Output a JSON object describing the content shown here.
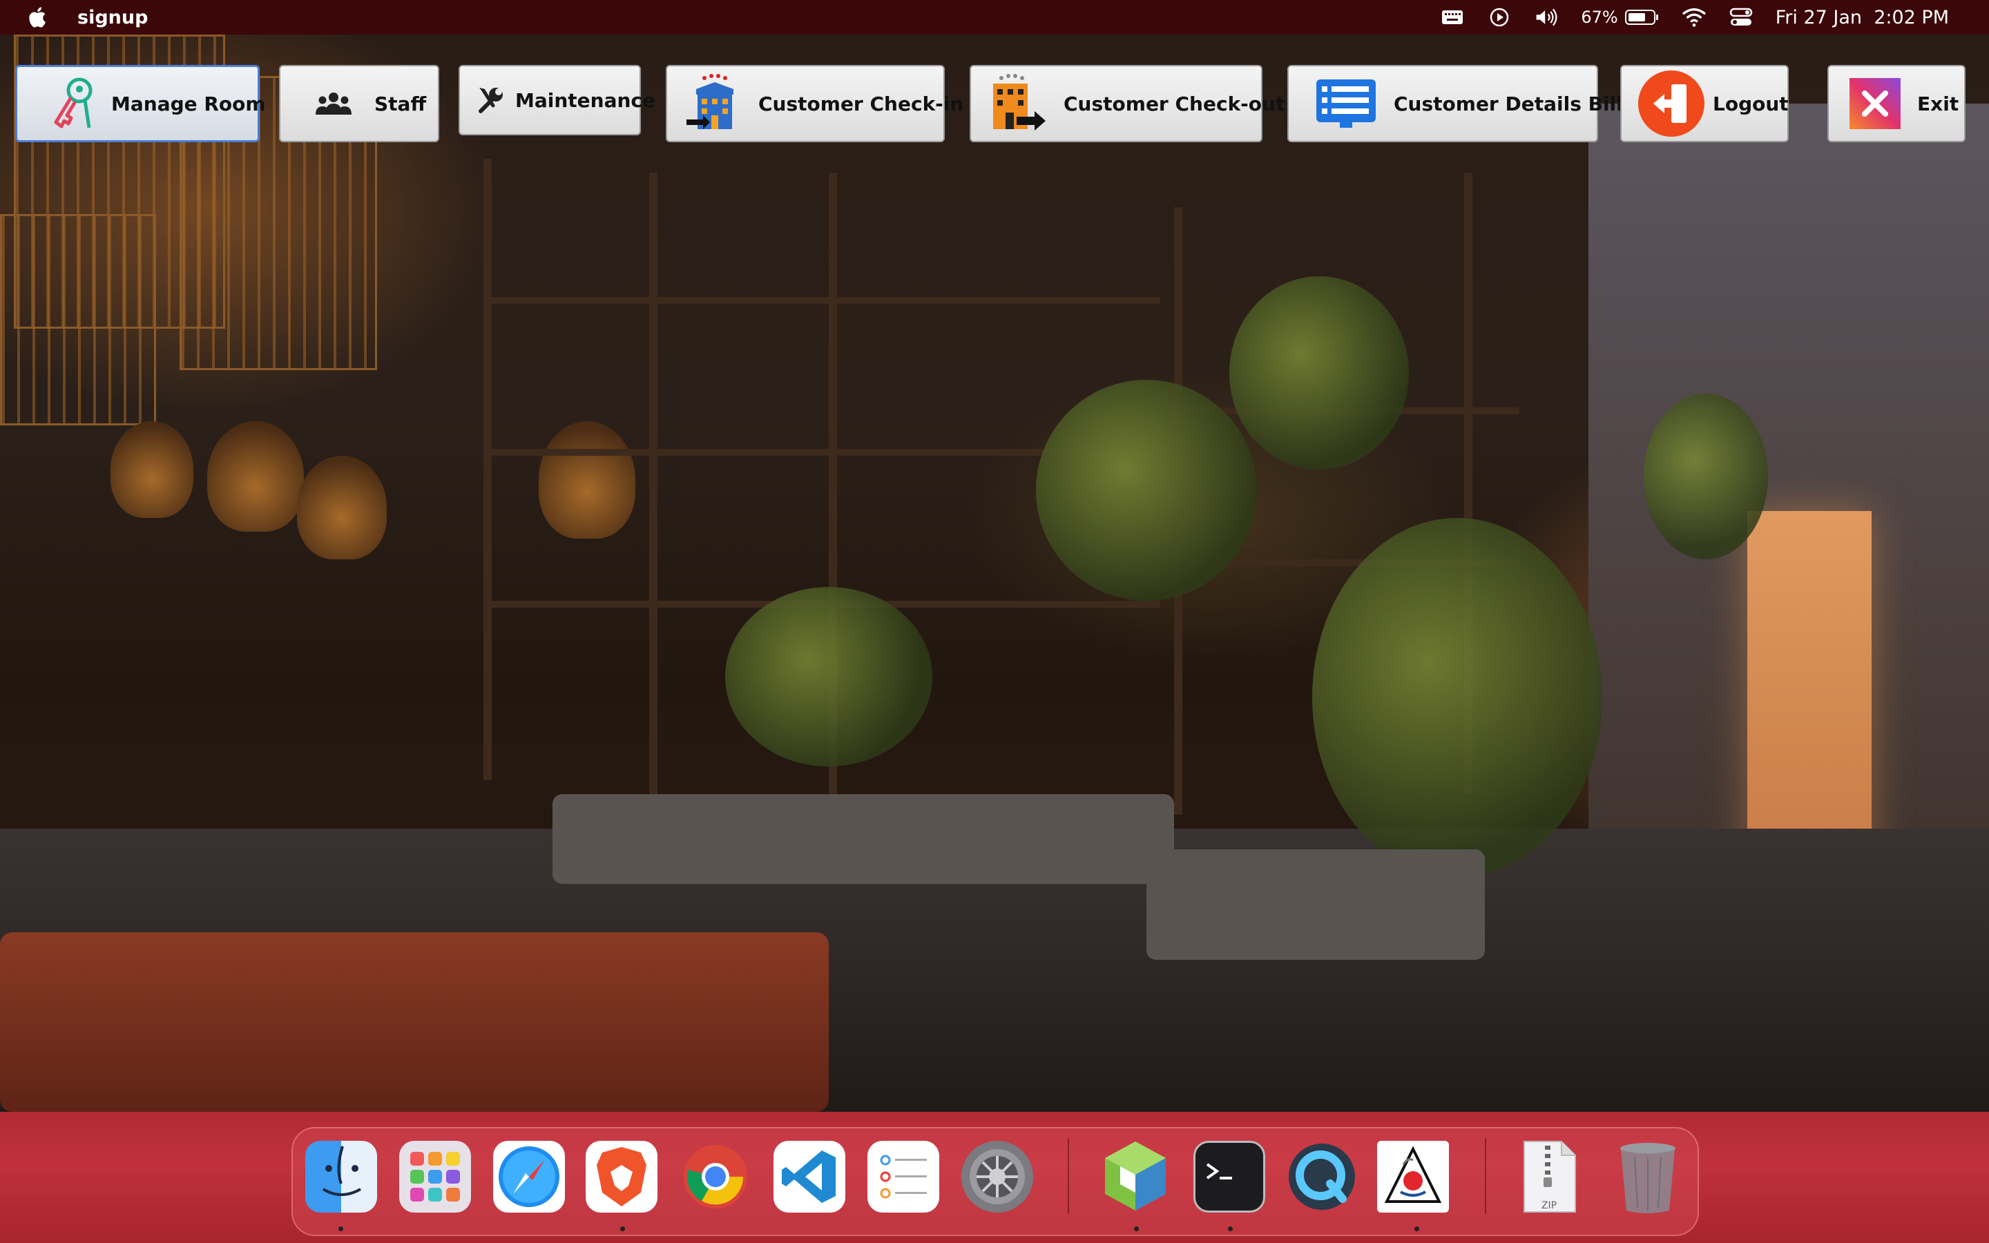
{
  "menubar": {
    "app_name": "signup",
    "battery": "67%",
    "clock": "Fri 27 Jan  2:02 PM"
  },
  "toolbar": {
    "manage_room": "Manage Room",
    "staff": "Staff",
    "maintenance": "Maintenance",
    "check_in": "Customer Check-in",
    "check_out": "Customer Check-out",
    "details_bill": "Customer Details Bill",
    "logout": "Logout",
    "exit": "Exit"
  },
  "dock": {
    "apps": [
      "Finder",
      "Launchpad",
      "Safari",
      "Brave",
      "Chrome",
      "VS Code",
      "Reminders",
      "System Settings",
      "NetBeans",
      "Terminal",
      "QuickTime",
      "Java",
      "Archive",
      "Trash"
    ],
    "zip_label": "ZIP"
  },
  "colors": {
    "menubar_bg": "#3b0708",
    "dock_bg": "#b22a34",
    "active_border": "#4a7fd4"
  }
}
